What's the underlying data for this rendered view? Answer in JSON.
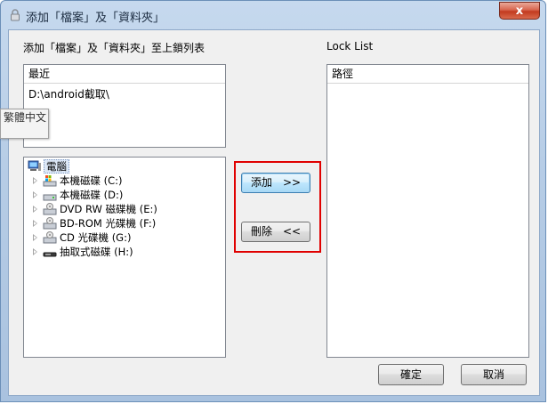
{
  "window": {
    "title": "添加「檔案」及「資料夾」",
    "close_label": "x"
  },
  "left_heading": "添加「檔案」及「資料夾」至上鎖列表",
  "right_heading": "Lock List",
  "recent": {
    "header": "最近",
    "items": [
      "D:\\android截取\\"
    ]
  },
  "tree": {
    "root": "電腦",
    "drives": [
      {
        "label": "本機磁碟 (C:)",
        "icon": "system-drive-icon"
      },
      {
        "label": "本機磁碟 (D:)",
        "icon": "hard-drive-icon"
      },
      {
        "label": "DVD RW 磁碟機 (E:)",
        "icon": "dvd-drive-icon"
      },
      {
        "label": "BD-ROM 光碟機 (F:)",
        "icon": "bd-drive-icon"
      },
      {
        "label": "CD 光碟機 (G:)",
        "icon": "cd-drive-icon"
      },
      {
        "label": "抽取式磁碟 (H:)",
        "icon": "removable-drive-icon"
      }
    ]
  },
  "buttons": {
    "add": "添加　>>",
    "remove": "刪除　<<",
    "ok": "確定",
    "cancel": "取消"
  },
  "lock_list": {
    "header": "路徑"
  },
  "tooltip": "繁體中文",
  "colors": {
    "highlight": "#e00000",
    "title_bar": "#b7cde6",
    "close_button": "#c23a1f"
  }
}
